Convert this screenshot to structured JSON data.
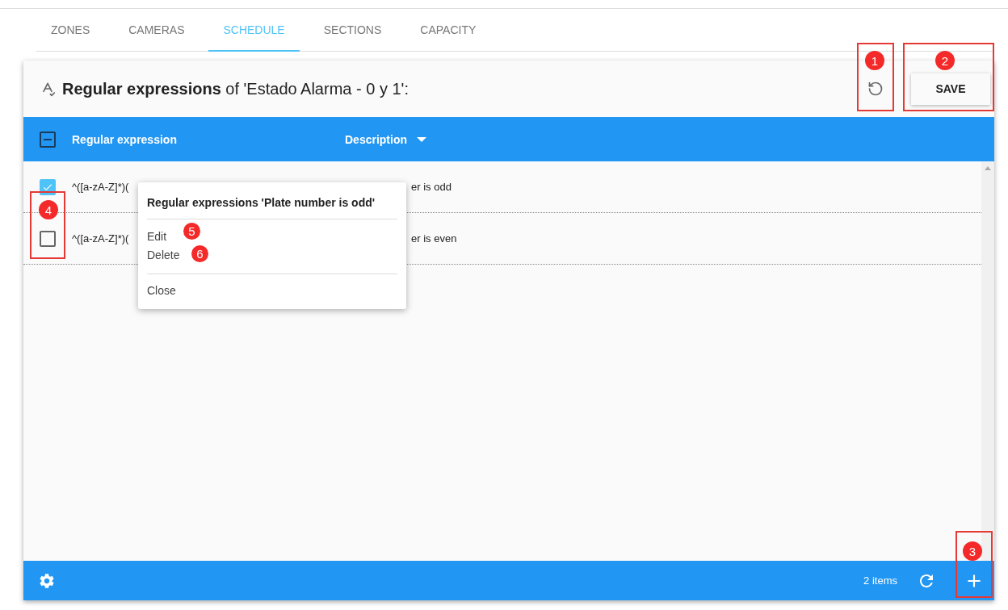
{
  "tabs": [
    {
      "label": "ZONES",
      "selected": false
    },
    {
      "label": "CAMERAS",
      "selected": false
    },
    {
      "label": "SCHEDULE",
      "selected": true
    },
    {
      "label": "SECTIONS",
      "selected": false
    },
    {
      "label": "CAPACITY",
      "selected": false
    }
  ],
  "title": "**Regular expressions** of 'Estado Alarma - 0 y 1':",
  "save_button": "SAVE",
  "table": {
    "select_all": {
      "indeterminate": true
    },
    "columns": [
      {
        "label": "Regular expression",
        "sorted": false
      },
      {
        "label": "Description",
        "sorted": true
      }
    ],
    "rows": [
      {
        "regex": "^([a-zA-Z]*)(",
        "description": "er is odd",
        "checked": true
      },
      {
        "regex": "^([a-zA-Z]*)(",
        "description": "er is even",
        "checked": false
      }
    ]
  },
  "context_menu": {
    "title": "Regular expressions 'Plate number is odd'",
    "items": [
      "Edit",
      "Delete"
    ],
    "close": "Close"
  },
  "footer": {
    "count": "2 items"
  },
  "annotations": [
    {
      "number": "1"
    },
    {
      "number": "2"
    },
    {
      "number": "3"
    },
    {
      "number": "4"
    },
    {
      "number": "5"
    },
    {
      "number": "6"
    }
  ]
}
